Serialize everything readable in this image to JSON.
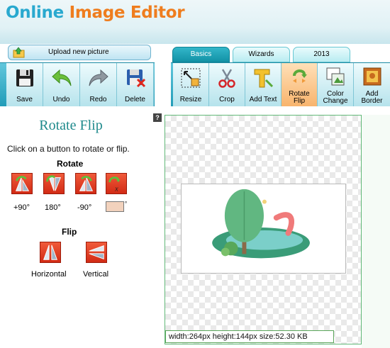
{
  "app": {
    "logo_part1": "Online ",
    "logo_part2": "Image Editor"
  },
  "upload": {
    "label": "Upload new picture"
  },
  "tabs": [
    {
      "label": "Basics",
      "active": true
    },
    {
      "label": "Wizards",
      "active": false
    },
    {
      "label": "2013",
      "active": false
    }
  ],
  "toolbar_left": [
    {
      "label": "Save",
      "icon": "floppy-disk-icon"
    },
    {
      "label": "Undo",
      "icon": "undo-arrow-icon"
    },
    {
      "label": "Redo",
      "icon": "redo-arrow-icon"
    },
    {
      "label": "Delete",
      "icon": "delete-icon"
    }
  ],
  "toolbar_right": [
    {
      "label": "Resize",
      "icon": "resize-icon"
    },
    {
      "label": "Crop",
      "icon": "scissors-icon"
    },
    {
      "label": "Add Text",
      "icon": "text-t-icon"
    },
    {
      "label_line1": "Rotate",
      "label_line2": "Flip",
      "icon": "rotate-flip-icon",
      "active": true
    },
    {
      "label_line1": "Color",
      "label_line2": "Change",
      "icon": "color-change-icon"
    },
    {
      "label_line1": "Add",
      "label_line2": "Border",
      "icon": "border-icon"
    }
  ],
  "panel": {
    "title": "Rotate Flip",
    "help": "?",
    "instruction": "Click on a button to rotate or flip.",
    "rotate": {
      "heading": "Rotate",
      "options": [
        "+90°",
        "180°",
        "-90°"
      ],
      "custom_suffix": "°",
      "custom_value": ""
    },
    "flip": {
      "heading": "Flip",
      "options": [
        "Horizontal",
        "Vertical"
      ]
    }
  },
  "image_info": {
    "status": "width:264px  height:144px  size:52.30 KB"
  },
  "colors": {
    "accent": "#1fa0ba",
    "active_tool": "#f8b46d",
    "title": "#1f8a8c",
    "rotate_button": "#e0401f",
    "logo_blue": "#29a9cf",
    "logo_orange": "#ef7d1e"
  }
}
